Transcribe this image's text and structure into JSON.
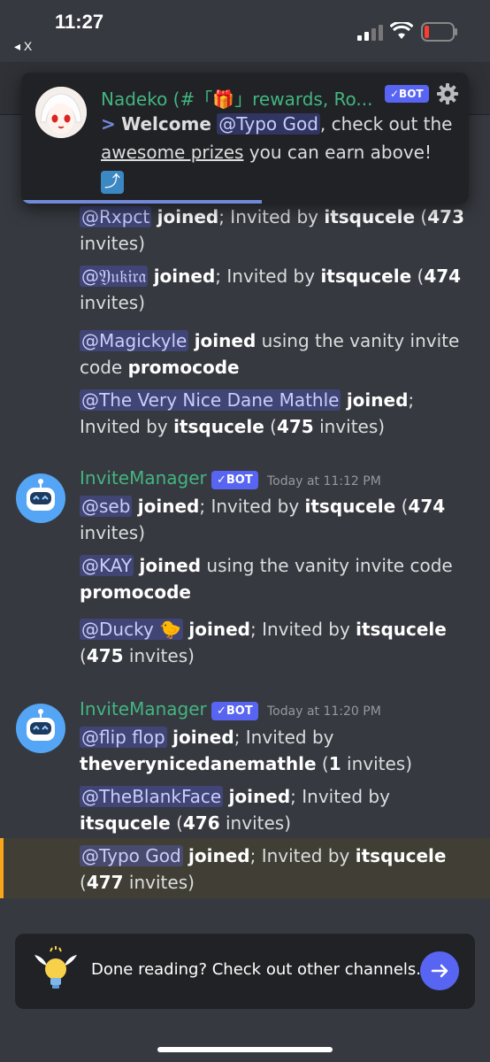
{
  "status": {
    "time": "11:27",
    "back_label": "◂ X"
  },
  "popup": {
    "title": "Nadeko (#「🎁」rewards, Ro...",
    "bot_tag": "✓BOT",
    "welcome": "Welcome",
    "mention": "@Typo God",
    "text1": ", check out the",
    "link": "awesome prizes",
    "text2": "you can earn above!",
    "emoji": "⤴"
  },
  "messages": {
    "m1": {
      "mention": "@Rxpct",
      "joined": "joined",
      "text": "; Invited by",
      "inviter": "itsqucele",
      "count": "473",
      "tail": "invites)"
    },
    "m2": {
      "mention": "@𝔜𝔲𝔨𝔦𝔯𝔞",
      "joined": "joined",
      "text": "; Invited by",
      "inviter": "itsqucele",
      "count": "474",
      "tail": "invites)"
    },
    "m3": {
      "mention": "@Magickyle",
      "joined": "joined",
      "text": "using the vanity invite code",
      "code": "promocode"
    },
    "m4": {
      "mention": "@The Very Nice Dane Mathle",
      "joined": "joined",
      "text": "; Invited by",
      "inviter": "itsqucele",
      "count": "475",
      "tail": "invites)"
    },
    "group1": {
      "author": "InviteManager",
      "bot_tag": "✓BOT",
      "timestamp": "Today at 11:12 PM"
    },
    "m5": {
      "mention": "@seb",
      "joined": "joined",
      "text": "; Invited by",
      "inviter": "itsqucele",
      "count": "474",
      "tail": "invites)"
    },
    "m6": {
      "mention": "@KAY",
      "joined": "joined",
      "text": "using the vanity invite code",
      "code": "promocode"
    },
    "m7": {
      "mention": "@Ducky 🐤",
      "joined": "joined",
      "text": "; Invited by",
      "inviter": "itsqucele",
      "count": "475",
      "tail": "invites)"
    },
    "group2": {
      "author": "InviteManager",
      "bot_tag": "✓BOT",
      "timestamp": "Today at 11:20 PM"
    },
    "m8": {
      "mention": "@flip flop",
      "joined": "joined",
      "text": "; Invited by",
      "inviter": "theverynicedanemathle",
      "count": "1",
      "tail": "invites)"
    },
    "m9": {
      "mention": "@TheBlankFace",
      "joined": "joined",
      "text": "; Invited by",
      "inviter": "itsqucele",
      "count": "476",
      "tail": "invites)"
    },
    "m10": {
      "mention": "@Typo God",
      "joined": "joined",
      "text": "; Invited by",
      "inviter": "itsqucele",
      "count": "477",
      "tail": "invites)"
    }
  },
  "banner": {
    "text": "Done reading? Check out other channels."
  },
  "colors": {
    "background": "#36393f",
    "bot_tag": "#5865f2",
    "author": "#43b581",
    "highlight_bar": "#faa61a"
  }
}
